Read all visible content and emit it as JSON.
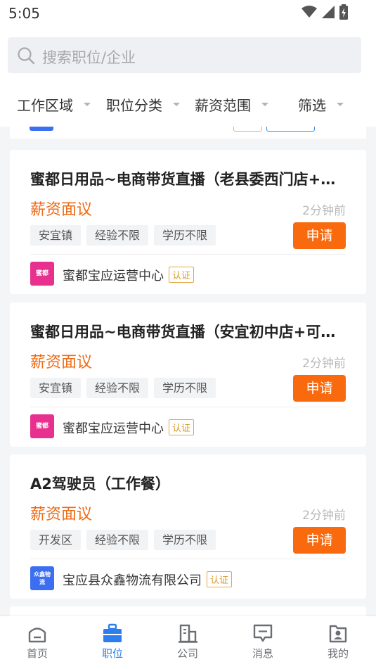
{
  "status_bar": {
    "time": "5:05"
  },
  "search": {
    "placeholder": "搜索职位/企业"
  },
  "filters": [
    {
      "label": "工作区域"
    },
    {
      "label": "职位分类"
    },
    {
      "label": "薪资范围"
    },
    {
      "label": "筛选"
    }
  ],
  "jobs": [
    {
      "title": "蜜都日用品~电商带货直播（老县委西门店+…",
      "salary": "薪资面议",
      "time_ago": "2分钟前",
      "tags": [
        "安宜镇",
        "经验不限",
        "学历不限"
      ],
      "apply_label": "申请",
      "company_logo_text": "蜜都",
      "company_name": "蜜都宝应运营中心",
      "badge": "认证"
    },
    {
      "title": "蜜都日用品~电商带货直播（安宜初中店+可…",
      "salary": "薪资面议",
      "time_ago": "2分钟前",
      "tags": [
        "安宜镇",
        "经验不限",
        "学历不限"
      ],
      "apply_label": "申请",
      "company_logo_text": "蜜都",
      "company_name": "蜜都宝应运营中心",
      "badge": "认证"
    },
    {
      "title": "A2驾驶员（工作餐）",
      "salary": "薪资面议",
      "time_ago": "2分钟前",
      "tags": [
        "开发区",
        "经验不限",
        "学历不限"
      ],
      "apply_label": "申请",
      "company_logo_text": "众鑫物流",
      "company_name": "宝应县众鑫物流有限公司",
      "badge": "认证"
    }
  ],
  "tabs": [
    {
      "label": "首页",
      "icon": "home-icon",
      "active": false
    },
    {
      "label": "职位",
      "icon": "briefcase-icon",
      "active": true
    },
    {
      "label": "公司",
      "icon": "building-icon",
      "active": false
    },
    {
      "label": "消息",
      "icon": "message-icon",
      "active": false
    },
    {
      "label": "我的",
      "icon": "profile-icon",
      "active": false
    }
  ],
  "colors": {
    "accent": "#2c7df0",
    "salary": "#f06a14",
    "apply_button": "#f96a0e",
    "mido_logo": "#e8318f",
    "zhongxin_logo": "#3b6ef0"
  }
}
